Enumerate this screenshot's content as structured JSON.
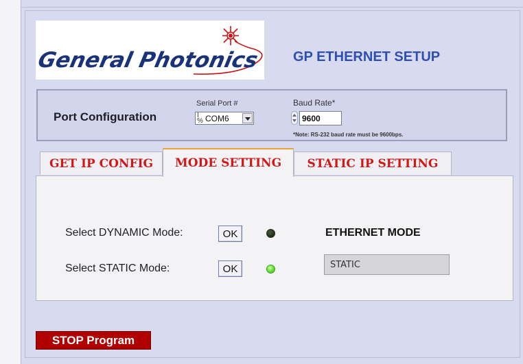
{
  "app": {
    "logo_text": "General Photonics",
    "title": "GP ETHERNET SETUP"
  },
  "port_config": {
    "label": "Port Configuration",
    "serial_port_label": "Serial Port #",
    "serial_port_value": "COM6",
    "serial_port_icon": "io-resource-icon",
    "baud_rate_label": "Baud Rate*",
    "baud_rate_value": "9600",
    "baud_note": "*Note: RS-232 baud rate must be 9600bps."
  },
  "tabs": [
    {
      "label": "GET IP CONFIG",
      "active": false
    },
    {
      "label": "MODE SETTING",
      "active": true
    },
    {
      "label": "STATIC IP SETTING",
      "active": false
    }
  ],
  "mode_setting": {
    "dynamic": {
      "label": "Select DYNAMIC Mode:",
      "button": "OK",
      "led_on": false
    },
    "static": {
      "label": "Select STATIC Mode:",
      "button": "OK",
      "led_on": true
    },
    "ethernet_mode_title": "ETHERNET MODE",
    "ethernet_mode_value": "STATIC"
  },
  "stop_button": "STOP Program",
  "colors": {
    "panel": "#d8daf0",
    "tab_text": "#d01818",
    "title": "#2d4fb0",
    "stop": "#b00000",
    "led_on": "#6fe23a",
    "led_off": "#1d2a14"
  }
}
